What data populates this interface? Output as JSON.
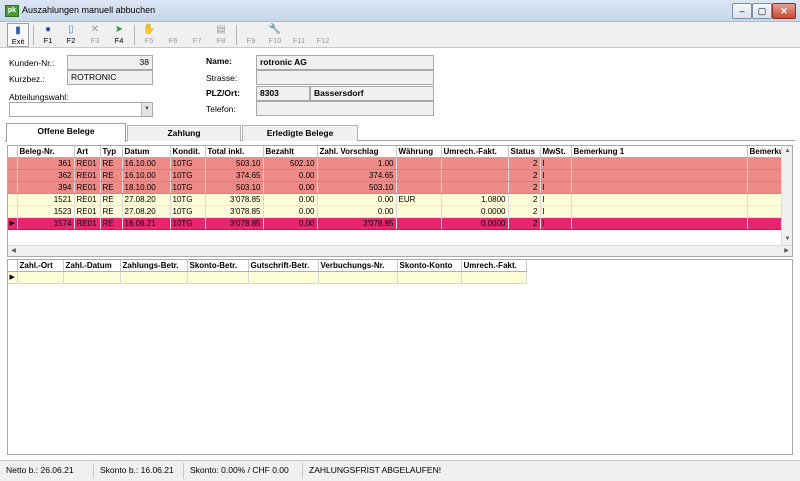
{
  "window": {
    "icon_text": "pk",
    "title": "Auszahlungen manuell abbuchen"
  },
  "toolbar": [
    {
      "key": "exit",
      "label": "Exit",
      "icon": "exit-door-icon",
      "enabled": true,
      "active": true
    },
    {
      "key": "f1",
      "label": "F1",
      "icon": "help-icon",
      "enabled": true
    },
    {
      "key": "f2",
      "label": "F2",
      "icon": "new-document-icon",
      "enabled": true
    },
    {
      "key": "f3",
      "label": "F3",
      "icon": "delete-x-icon",
      "enabled": false
    },
    {
      "key": "f4",
      "label": "F4",
      "icon": "green-arrow-icon",
      "enabled": true
    },
    {
      "key": "f5",
      "label": "F5",
      "icon": "hand-icon",
      "enabled": false
    },
    {
      "key": "f6",
      "label": "F6",
      "icon": "",
      "enabled": false
    },
    {
      "key": "f7",
      "label": "F7",
      "icon": "",
      "enabled": false
    },
    {
      "key": "f8",
      "label": "F8",
      "icon": "print-icon",
      "enabled": false
    },
    {
      "key": "f9",
      "label": "F9",
      "icon": "",
      "enabled": false
    },
    {
      "key": "f10",
      "label": "F10",
      "icon": "tools-icon",
      "enabled": false
    },
    {
      "key": "f11",
      "label": "F11",
      "icon": "",
      "enabled": false
    },
    {
      "key": "f12",
      "label": "F12",
      "icon": "",
      "enabled": false
    }
  ],
  "form": {
    "kunden_nr_label": "Kunden-Nr.:",
    "kunden_nr_value": "38",
    "kurzbez_label": "Kurzbez.:",
    "kurzbez_value": "ROTRONIC",
    "abteilung_label": "Abteilungswahl:",
    "abteilung_value": "",
    "name_label": "Name:",
    "name_value": "rotronic AG",
    "strasse_label": "Strasse:",
    "strasse_value": "",
    "plz_ort_label": "PLZ/Ort:",
    "plz_value": "8303",
    "ort_value": "Bassersdorf",
    "telefon_label": "Telefon:",
    "telefon_value": ""
  },
  "tabs": [
    {
      "label": "Offene Belege",
      "selected": true
    },
    {
      "label": "Zahlung",
      "selected": false
    },
    {
      "label": "Erledigte Belege",
      "selected": false
    }
  ],
  "belege_grid": {
    "columns": [
      "Beleg-Nr.",
      "Art",
      "Typ",
      "Datum",
      "Kondit.",
      "Total inkl.",
      "Bezahlt",
      "Zahl. Vorschlag",
      "Währung",
      "Umrech.-Fakt.",
      "Status",
      "MwSt.",
      "Bemerkung 1",
      "Bemerkung"
    ],
    "rows": [
      {
        "style": "red",
        "current": false,
        "cells": [
          "361",
          "RE01",
          "RE",
          "16.10.00",
          "10TG",
          "503.10",
          "502.10",
          "1.00",
          "",
          "",
          "2",
          "I",
          "",
          ""
        ]
      },
      {
        "style": "red",
        "current": false,
        "cells": [
          "362",
          "RE01",
          "RE",
          "16.10.00",
          "10TG",
          "374.65",
          "0.00",
          "374.65",
          "",
          "",
          "2",
          "I",
          "",
          ""
        ]
      },
      {
        "style": "red",
        "current": false,
        "cells": [
          "394",
          "RE01",
          "RE",
          "18.10.00",
          "10TG",
          "503.10",
          "0.00",
          "503.10",
          "",
          "",
          "2",
          "I",
          "",
          ""
        ]
      },
      {
        "style": "yellow",
        "current": false,
        "cells": [
          "1521",
          "RE01",
          "RE",
          "27.08.20",
          "10TG",
          "3'078.85",
          "0.00",
          "0.00",
          "EUR",
          "1.0800",
          "2",
          "I",
          "",
          ""
        ]
      },
      {
        "style": "yellow",
        "current": false,
        "cells": [
          "1523",
          "RE01",
          "RE",
          "27.08.20",
          "10TG",
          "3'078.85",
          "0.00",
          "0.00",
          "",
          "0.0000",
          "2",
          "I",
          "",
          ""
        ]
      },
      {
        "style": "magenta",
        "current": true,
        "cells": [
          "1574",
          "RE01",
          "RE",
          "16.06.21",
          "10TG",
          "3'078.85",
          "0.00",
          "3'078.85",
          "",
          "0.0000",
          "2",
          "I",
          "",
          ""
        ]
      }
    ]
  },
  "zahlung_grid": {
    "columns": [
      "Zahl.-Ort",
      "Zahl.-Datum",
      "Zahlungs-Betr.",
      "Skonto-Betr.",
      "Gutschrift-Betr.",
      "Verbuchungs-Nr.",
      "Skonto-Konto",
      "Umrech.-Fakt."
    ],
    "rows": [
      {
        "current": true,
        "cells": [
          "",
          "",
          "",
          "",
          "",
          "",
          "",
          ""
        ]
      }
    ]
  },
  "statusbar": {
    "netto": "Netto b.: 26.06.21",
    "skonto_bis": "Skonto b.: 16.06.21",
    "skonto": "Skonto: 0.00% / CHF 0.00",
    "message": "ZAHLUNGSFRIST ABGELAUFEN!"
  },
  "colors": {
    "row_red": "#ee8b89",
    "row_yellow": "#fdfcd9",
    "row_magenta": "#e8266f"
  }
}
